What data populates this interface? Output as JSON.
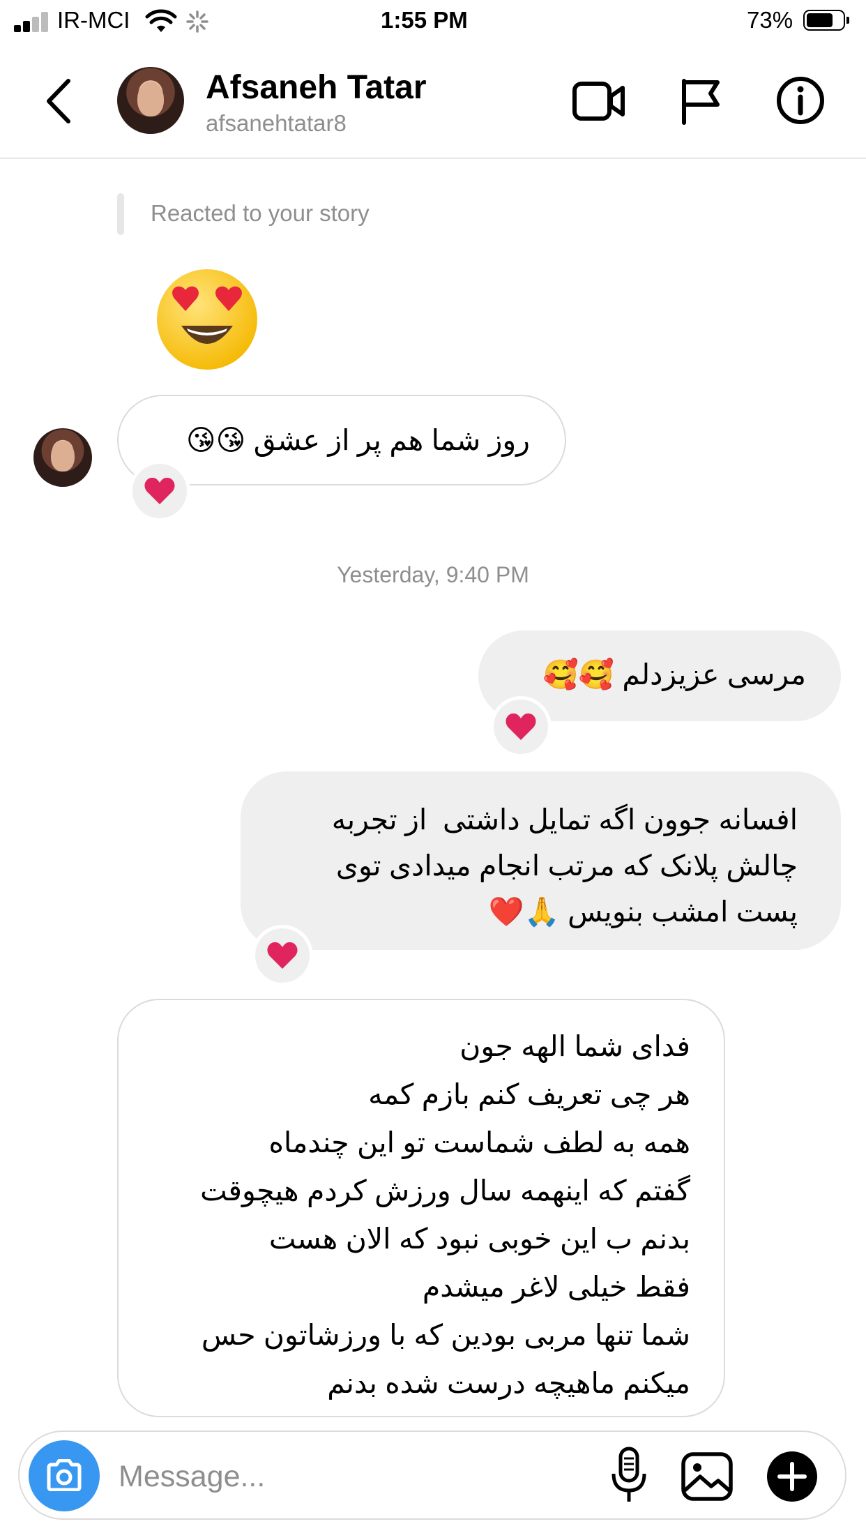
{
  "status_bar": {
    "carrier": "IR-MCI",
    "time": "1:55 PM",
    "battery_percent": "73%",
    "battery_level": 0.73,
    "icons": [
      "signal-icon",
      "wifi-icon",
      "activity-spinner-icon",
      "battery-icon"
    ]
  },
  "header": {
    "name": "Afsaneh Tatar",
    "username": "afsanehtatar8",
    "icons": [
      "back-chevron-icon",
      "video-call-icon",
      "flag-icon",
      "info-icon"
    ]
  },
  "story_reaction": {
    "label": "Reacted to your story",
    "emoji": "heart-eyes-emoji"
  },
  "messages": [
    {
      "direction": "incoming",
      "text": "روز شما هم پر از عشق 😘😘",
      "reaction": "heart"
    },
    {
      "direction": "outgoing",
      "text": "مرسی عزیزدلم 🥰🥰",
      "reaction": "heart"
    },
    {
      "direction": "outgoing",
      "text": "افسانه جوون اگه تمایل داشتی  از تجربه\nچالش پلانک که مرتب انجام میدادی توی\nپست امشب بنویس 🙏❤️",
      "reaction": "heart"
    },
    {
      "direction": "incoming",
      "text": "فدای شما الهه جون\nهر چی تعریف کنم بازم کمه\nهمه به لطف شماست تو این چندماه\nگفتم که اینهمه سال ورزش کردم هیچوقت\nبدنم ب این خوبی نبود که الان هست\nفقط خیلی لاغر میشدم\nشما تنها مربی بودین که با ورزشاتون حس\nمیکنم ماهیچه درست شده بدنم",
      "reaction": ""
    }
  ],
  "timestamp": "Yesterday, 9:40 PM",
  "composer": {
    "placeholder": "Message...",
    "value": "",
    "icons": [
      "camera-icon",
      "microphone-icon",
      "gallery-icon",
      "plus-icon"
    ]
  },
  "colors": {
    "accent_blue": "#3897f0",
    "outgoing_bubble": "#efefef",
    "muted_text": "#8e8e8e",
    "heart_red": "#e0245e"
  }
}
